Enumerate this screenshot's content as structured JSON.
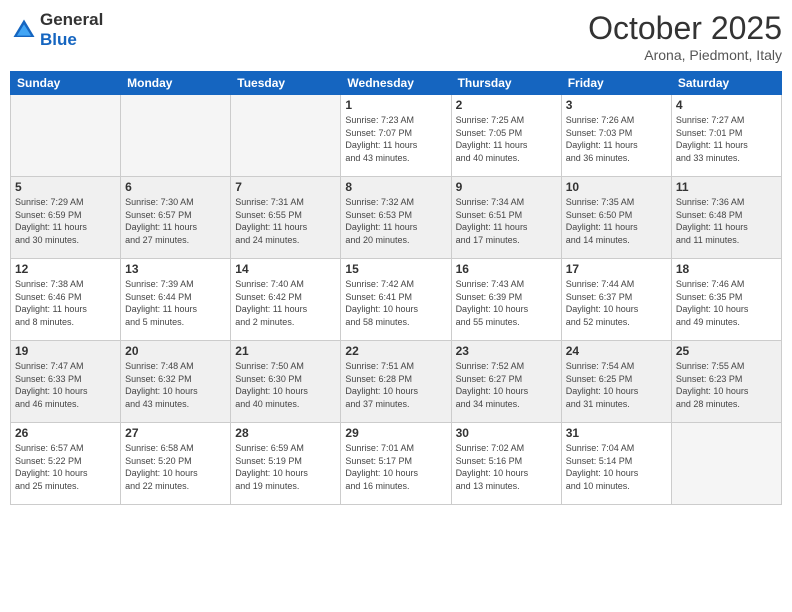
{
  "header": {
    "logo_general": "General",
    "logo_blue": "Blue",
    "month_title": "October 2025",
    "location": "Arona, Piedmont, Italy"
  },
  "weekdays": [
    "Sunday",
    "Monday",
    "Tuesday",
    "Wednesday",
    "Thursday",
    "Friday",
    "Saturday"
  ],
  "weeks": [
    [
      {
        "day": "",
        "info": ""
      },
      {
        "day": "",
        "info": ""
      },
      {
        "day": "",
        "info": ""
      },
      {
        "day": "1",
        "info": "Sunrise: 7:23 AM\nSunset: 7:07 PM\nDaylight: 11 hours\nand 43 minutes."
      },
      {
        "day": "2",
        "info": "Sunrise: 7:25 AM\nSunset: 7:05 PM\nDaylight: 11 hours\nand 40 minutes."
      },
      {
        "day": "3",
        "info": "Sunrise: 7:26 AM\nSunset: 7:03 PM\nDaylight: 11 hours\nand 36 minutes."
      },
      {
        "day": "4",
        "info": "Sunrise: 7:27 AM\nSunset: 7:01 PM\nDaylight: 11 hours\nand 33 minutes."
      }
    ],
    [
      {
        "day": "5",
        "info": "Sunrise: 7:29 AM\nSunset: 6:59 PM\nDaylight: 11 hours\nand 30 minutes."
      },
      {
        "day": "6",
        "info": "Sunrise: 7:30 AM\nSunset: 6:57 PM\nDaylight: 11 hours\nand 27 minutes."
      },
      {
        "day": "7",
        "info": "Sunrise: 7:31 AM\nSunset: 6:55 PM\nDaylight: 11 hours\nand 24 minutes."
      },
      {
        "day": "8",
        "info": "Sunrise: 7:32 AM\nSunset: 6:53 PM\nDaylight: 11 hours\nand 20 minutes."
      },
      {
        "day": "9",
        "info": "Sunrise: 7:34 AM\nSunset: 6:51 PM\nDaylight: 11 hours\nand 17 minutes."
      },
      {
        "day": "10",
        "info": "Sunrise: 7:35 AM\nSunset: 6:50 PM\nDaylight: 11 hours\nand 14 minutes."
      },
      {
        "day": "11",
        "info": "Sunrise: 7:36 AM\nSunset: 6:48 PM\nDaylight: 11 hours\nand 11 minutes."
      }
    ],
    [
      {
        "day": "12",
        "info": "Sunrise: 7:38 AM\nSunset: 6:46 PM\nDaylight: 11 hours\nand 8 minutes."
      },
      {
        "day": "13",
        "info": "Sunrise: 7:39 AM\nSunset: 6:44 PM\nDaylight: 11 hours\nand 5 minutes."
      },
      {
        "day": "14",
        "info": "Sunrise: 7:40 AM\nSunset: 6:42 PM\nDaylight: 11 hours\nand 2 minutes."
      },
      {
        "day": "15",
        "info": "Sunrise: 7:42 AM\nSunset: 6:41 PM\nDaylight: 10 hours\nand 58 minutes."
      },
      {
        "day": "16",
        "info": "Sunrise: 7:43 AM\nSunset: 6:39 PM\nDaylight: 10 hours\nand 55 minutes."
      },
      {
        "day": "17",
        "info": "Sunrise: 7:44 AM\nSunset: 6:37 PM\nDaylight: 10 hours\nand 52 minutes."
      },
      {
        "day": "18",
        "info": "Sunrise: 7:46 AM\nSunset: 6:35 PM\nDaylight: 10 hours\nand 49 minutes."
      }
    ],
    [
      {
        "day": "19",
        "info": "Sunrise: 7:47 AM\nSunset: 6:33 PM\nDaylight: 10 hours\nand 46 minutes."
      },
      {
        "day": "20",
        "info": "Sunrise: 7:48 AM\nSunset: 6:32 PM\nDaylight: 10 hours\nand 43 minutes."
      },
      {
        "day": "21",
        "info": "Sunrise: 7:50 AM\nSunset: 6:30 PM\nDaylight: 10 hours\nand 40 minutes."
      },
      {
        "day": "22",
        "info": "Sunrise: 7:51 AM\nSunset: 6:28 PM\nDaylight: 10 hours\nand 37 minutes."
      },
      {
        "day": "23",
        "info": "Sunrise: 7:52 AM\nSunset: 6:27 PM\nDaylight: 10 hours\nand 34 minutes."
      },
      {
        "day": "24",
        "info": "Sunrise: 7:54 AM\nSunset: 6:25 PM\nDaylight: 10 hours\nand 31 minutes."
      },
      {
        "day": "25",
        "info": "Sunrise: 7:55 AM\nSunset: 6:23 PM\nDaylight: 10 hours\nand 28 minutes."
      }
    ],
    [
      {
        "day": "26",
        "info": "Sunrise: 6:57 AM\nSunset: 5:22 PM\nDaylight: 10 hours\nand 25 minutes."
      },
      {
        "day": "27",
        "info": "Sunrise: 6:58 AM\nSunset: 5:20 PM\nDaylight: 10 hours\nand 22 minutes."
      },
      {
        "day": "28",
        "info": "Sunrise: 6:59 AM\nSunset: 5:19 PM\nDaylight: 10 hours\nand 19 minutes."
      },
      {
        "day": "29",
        "info": "Sunrise: 7:01 AM\nSunset: 5:17 PM\nDaylight: 10 hours\nand 16 minutes."
      },
      {
        "day": "30",
        "info": "Sunrise: 7:02 AM\nSunset: 5:16 PM\nDaylight: 10 hours\nand 13 minutes."
      },
      {
        "day": "31",
        "info": "Sunrise: 7:04 AM\nSunset: 5:14 PM\nDaylight: 10 hours\nand 10 minutes."
      },
      {
        "day": "",
        "info": ""
      }
    ]
  ]
}
